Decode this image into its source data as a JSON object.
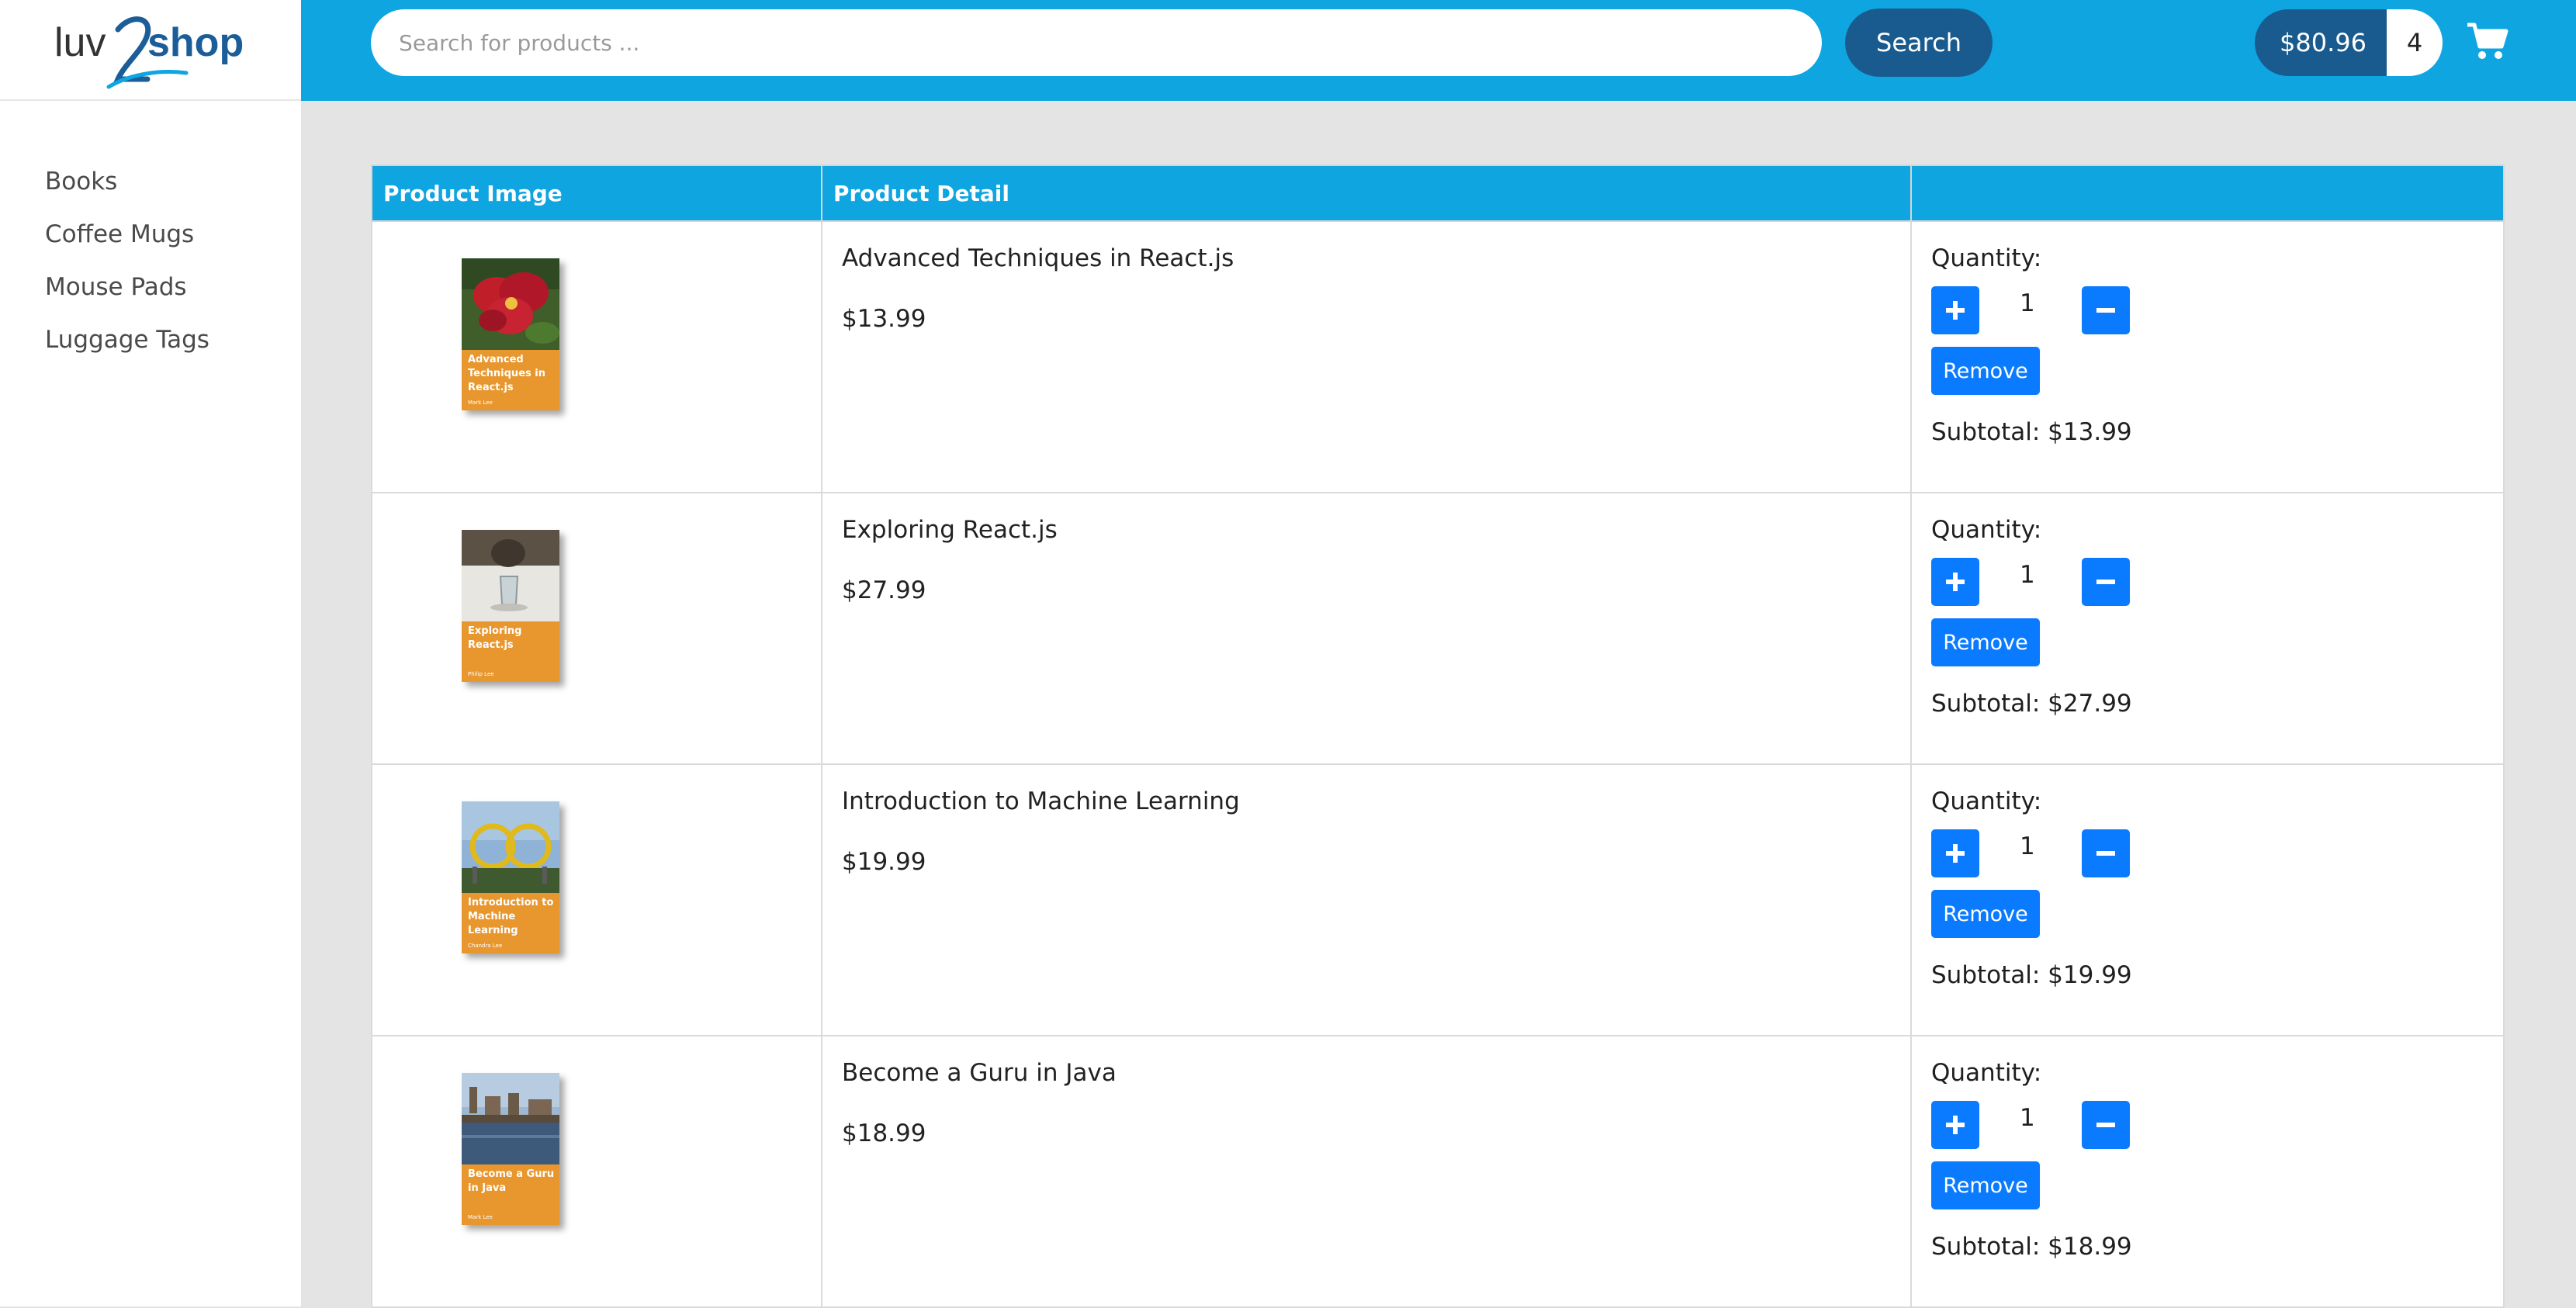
{
  "brand": {
    "logo_text_left": "luv",
    "logo_text_right": "shop"
  },
  "sidebar": {
    "items": [
      {
        "label": "Books"
      },
      {
        "label": "Coffee Mugs"
      },
      {
        "label": "Mouse Pads"
      },
      {
        "label": "Luggage Tags"
      }
    ]
  },
  "header": {
    "search_placeholder": "Search for products ...",
    "search_button": "Search",
    "cart_total": "$80.96",
    "cart_quantity": "4",
    "cart_icon": "shopping-cart-icon"
  },
  "table": {
    "columns": [
      "Product Image",
      "Product Detail",
      ""
    ],
    "quantity_label": "Quantity:",
    "remove_label": "Remove",
    "rows": [
      {
        "name": "Advanced Techniques in React.js",
        "price": "$13.99",
        "quantity": "1",
        "subtotal": "Subtotal: $13.99",
        "cover_title": "Advanced Techniques in React.js",
        "cover_author": "Mark Lee",
        "cover_photo": "red-flower"
      },
      {
        "name": "Exploring React.js",
        "price": "$27.99",
        "quantity": "1",
        "subtotal": "Subtotal: $27.99",
        "cover_title": "Exploring React.js",
        "cover_author": "Philip Lee",
        "cover_photo": "glass-on-table"
      },
      {
        "name": "Introduction to Machine Learning",
        "price": "$19.99",
        "quantity": "1",
        "subtotal": "Subtotal: $19.99",
        "cover_title": "Introduction to Machine Learning",
        "cover_author": "Chandra Lee",
        "cover_photo": "roller-coaster"
      },
      {
        "name": "Become a Guru in Java",
        "price": "$18.99",
        "quantity": "1",
        "subtotal": "Subtotal: $18.99",
        "cover_title": "Become a Guru in Java",
        "cover_author": "Mark Lee",
        "cover_photo": "city-river"
      }
    ]
  },
  "colors": {
    "header_bg": "#0ea5e1",
    "dark_blue": "#195b8e",
    "button_blue": "#0a7bff",
    "cover_orange": "#e8972e",
    "page_bg": "#e4e4e4"
  }
}
